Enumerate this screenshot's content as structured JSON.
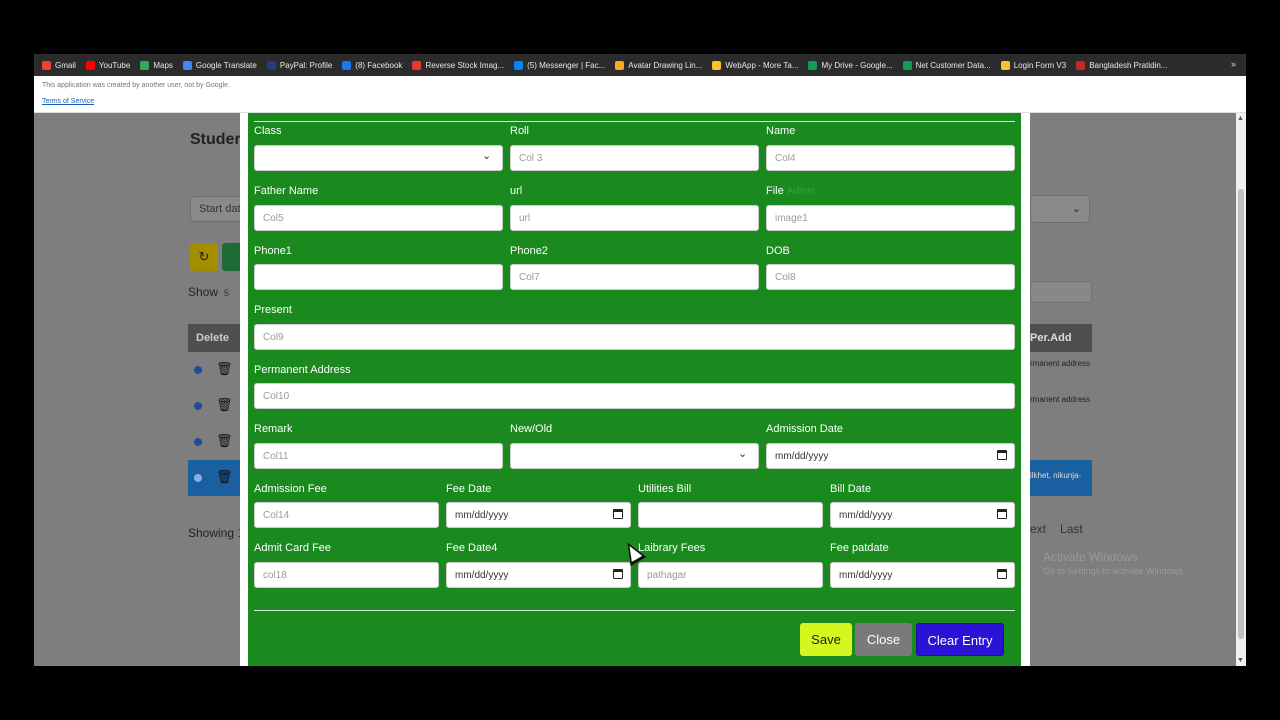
{
  "bookmarks": [
    {
      "label": "Gmail",
      "color": "#ea4335"
    },
    {
      "label": "YouTube",
      "color": "#ff0000"
    },
    {
      "label": "Maps",
      "color": "#34a853"
    },
    {
      "label": "Google Translate",
      "color": "#4285f4"
    },
    {
      "label": "PayPal: Profile",
      "color": "#253b80"
    },
    {
      "label": "(8) Facebook",
      "color": "#1877f2"
    },
    {
      "label": "Reverse Stock Imag...",
      "color": "#e53935"
    },
    {
      "label": "(5) Messenger | Fac...",
      "color": "#0084ff"
    },
    {
      "label": "Avatar Drawing Lin...",
      "color": "#f9a825"
    },
    {
      "label": "WebApp - More Ta...",
      "color": "#fbc02d"
    },
    {
      "label": "My Drive - Google...",
      "color": "#0f9d58"
    },
    {
      "label": "Net Customer Data...",
      "color": "#0f9d58"
    },
    {
      "label": "Login Form V3",
      "color": "#fbc02d"
    },
    {
      "label": "Bangladesh Pratidin...",
      "color": "#c62828"
    }
  ],
  "bookmarks_more": "»",
  "notice": {
    "text": "This application was created by another user, not by Google.",
    "terms": "Terms of Service"
  },
  "background": {
    "title": "Studer",
    "start_placeholder": "Start dat",
    "show_label": "Show",
    "show_value": "5",
    "delete_header": "Delete",
    "showing": "Showing 1",
    "peradd_header": "Per.Add",
    "cells": [
      "rmanent address",
      "rmanent address",
      "",
      "ilkhet, nikunja-"
    ],
    "pager_next": "ext",
    "pager_last": "Last"
  },
  "watermark": {
    "line1": "Activate Windows",
    "line2": "Go to Settings to activate Windows."
  },
  "form": {
    "class": {
      "label": "Class",
      "value": ""
    },
    "roll": {
      "label": "Roll",
      "placeholder": "Col 3"
    },
    "name": {
      "label": "Name",
      "placeholder": "Col4"
    },
    "father_name": {
      "label": "Father Name",
      "placeholder": "Col5"
    },
    "url": {
      "label": "url",
      "placeholder": "url"
    },
    "file": {
      "label": "File",
      "alt": "Admin",
      "placeholder": "image1"
    },
    "phone1": {
      "label": "Phone1",
      "placeholder": ""
    },
    "phone2": {
      "label": "Phone2",
      "placeholder": "Col7"
    },
    "dob": {
      "label": "DOB",
      "placeholder": "Col8"
    },
    "present": {
      "label": "Present",
      "placeholder": "Col9"
    },
    "permanent": {
      "label": "Permanent Address",
      "placeholder": "Col10"
    },
    "remark": {
      "label": "Remark",
      "placeholder": "Col11"
    },
    "new_old": {
      "label": "New/Old",
      "value": ""
    },
    "admission_date": {
      "label": "Admission Date",
      "placeholder": "mm/dd/yyyy"
    },
    "admission_fee": {
      "label": "Admission Fee",
      "placeholder": "Col14"
    },
    "fee_date": {
      "label": "Fee Date",
      "placeholder": "mm/dd/yyyy"
    },
    "utilities_bill": {
      "label": "Utilities Bill",
      "placeholder": ""
    },
    "bill_date": {
      "label": "Bill Date",
      "placeholder": "mm/dd/yyyy"
    },
    "admit_card_fee": {
      "label": "Admit Card Fee",
      "placeholder": "col18"
    },
    "fee_date4": {
      "label": "Fee Date4",
      "placeholder": "mm/dd/yyyy"
    },
    "laibrary_fees": {
      "label": "Laibrary Fees",
      "placeholder": "pathagar"
    },
    "fee_patdate": {
      "label": "Fee patdate",
      "placeholder": "mm/dd/yyyy"
    }
  },
  "buttons": {
    "save": "Save",
    "close": "Close",
    "clear": "Clear Entry"
  },
  "colors": {
    "modal_bg": "#1a8a1f",
    "save": "#d4f71d",
    "close": "#7a7a7a",
    "clear": "#2b13d6"
  }
}
